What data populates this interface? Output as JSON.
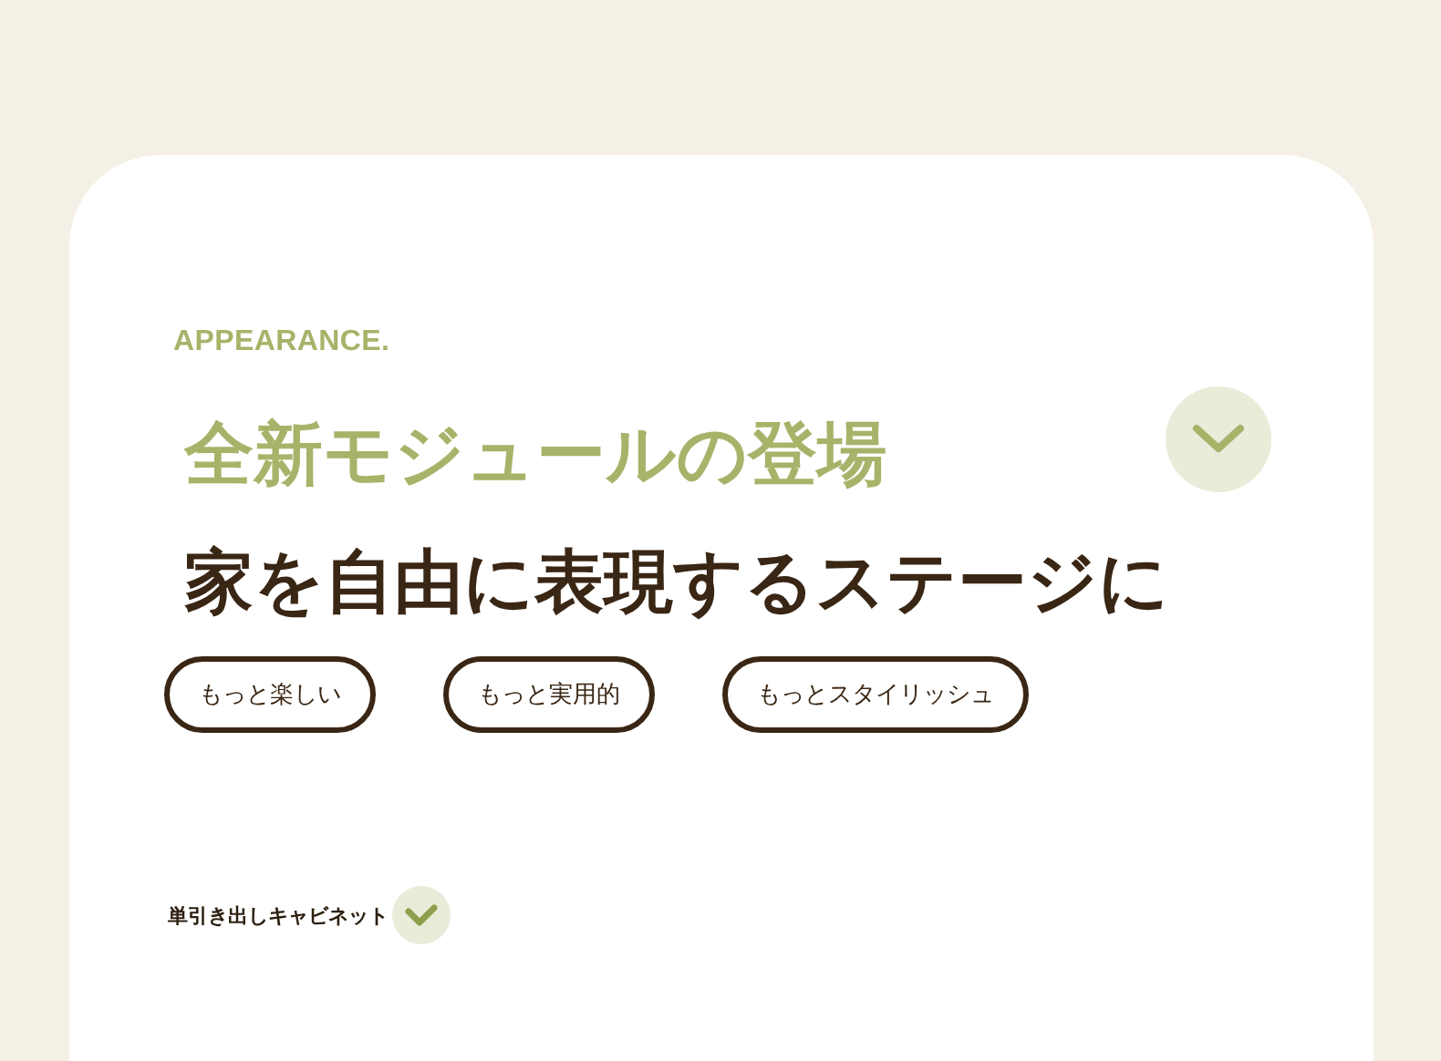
{
  "eyebrow": "APPEARANCE.",
  "title": "全新モジュールの登場",
  "subtitle": "家を自由に表現するステージに",
  "tags": [
    "もっと楽しい",
    "もっと実用的",
    "もっとスタイリッシュ"
  ],
  "item": {
    "label": "単引き出しキャビネット"
  }
}
